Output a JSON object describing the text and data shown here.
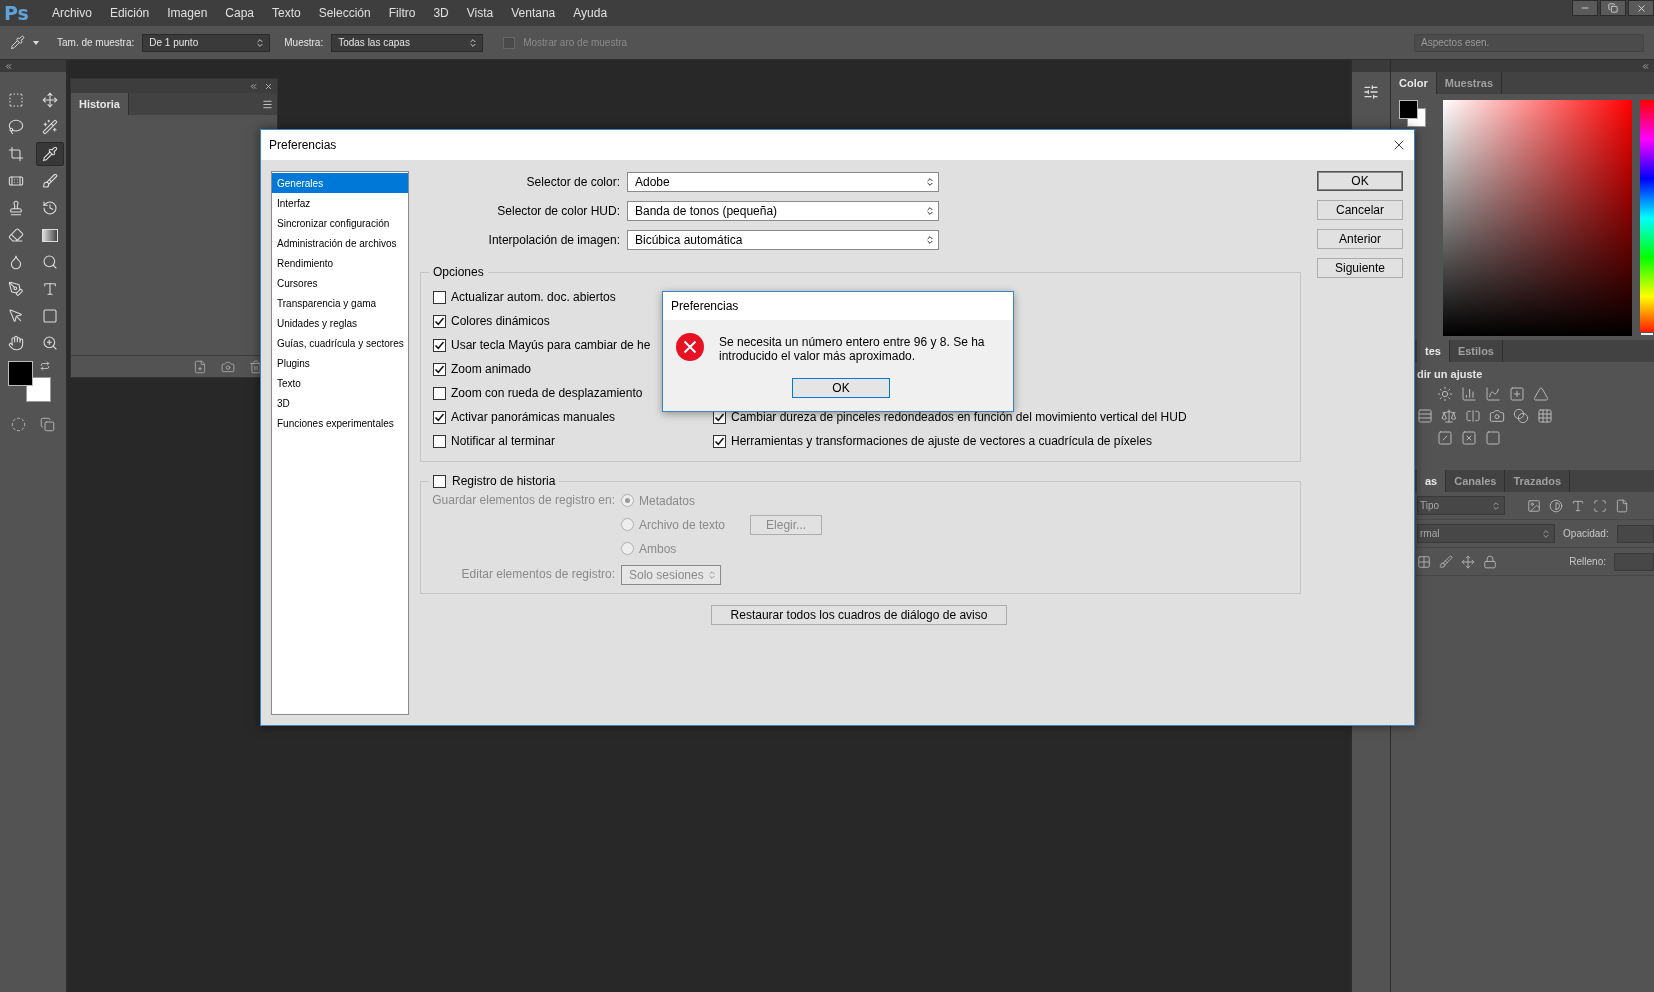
{
  "menu_bar": {
    "logo": "Ps",
    "items": [
      "Archivo",
      "Edición",
      "Imagen",
      "Capa",
      "Texto",
      "Selección",
      "Filtro",
      "3D",
      "Vista",
      "Ventana",
      "Ayuda"
    ]
  },
  "options_bar": {
    "sample_size_label": "Tam. de muestra:",
    "sample_size": "De 1 punto",
    "sample_label": "Muestra:",
    "sample": "Todas las capas",
    "show_ring": {
      "label": "Mostrar aro de muestra",
      "checked": false
    },
    "workspace": "Aspectos esen."
  },
  "tools": [
    {
      "kind": "marquee",
      "selected": false
    },
    {
      "kind": "move",
      "selected": false
    },
    {
      "kind": "lasso",
      "selected": false
    },
    {
      "kind": "quick_select",
      "selected": false
    },
    {
      "kind": "crop",
      "selected": false
    },
    {
      "kind": "eyedropper",
      "selected": true
    },
    {
      "kind": "healing",
      "selected": false
    },
    {
      "kind": "brush",
      "selected": false
    },
    {
      "kind": "stamp",
      "selected": false
    },
    {
      "kind": "history_brush",
      "selected": false
    },
    {
      "kind": "eraser",
      "selected": false
    },
    {
      "kind": "gradient",
      "selected": false
    },
    {
      "kind": "blur",
      "selected": false
    },
    {
      "kind": "dodge",
      "selected": false
    },
    {
      "kind": "pen",
      "selected": false
    },
    {
      "kind": "type",
      "selected": false
    },
    {
      "kind": "path_select",
      "selected": false
    },
    {
      "kind": "shape",
      "selected": false
    },
    {
      "kind": "hand",
      "selected": false
    },
    {
      "kind": "zoom",
      "selected": false
    }
  ],
  "history_panel": {
    "tab": "Historia"
  },
  "color_panel": {
    "tabs": [
      {
        "label": "Color",
        "selected": true
      },
      {
        "label": "Muestras",
        "selected": false
      }
    ],
    "hue": {
      "level": 0
    }
  },
  "adjustments_panel": {
    "tabs": [
      {
        "label": "tes",
        "selected": true
      },
      {
        "label": "Estilos",
        "selected": false
      }
    ],
    "heading": "dir un ajuste"
  },
  "layers_panel": {
    "tabs": [
      {
        "label": "as",
        "selected": true
      },
      {
        "label": "Canales",
        "selected": false
      },
      {
        "label": "Trazados",
        "selected": false
      }
    ],
    "filter": "Tipo",
    "blend_mode": "rmal",
    "opacity_label": "Opacidad:",
    "fill_label": "Relleno:"
  },
  "preferences_dialog": {
    "title": "Preferencias",
    "categories": [
      {
        "label": "Generales",
        "selected": true
      },
      {
        "label": "Interfaz",
        "selected": false
      },
      {
        "label": "Sincronizar configuración",
        "selected": false
      },
      {
        "label": "Administración de archivos",
        "selected": false
      },
      {
        "label": "Rendimiento",
        "selected": false
      },
      {
        "label": "Cursores",
        "selected": false
      },
      {
        "label": "Transparencia y gama",
        "selected": false
      },
      {
        "label": "Unidades y reglas",
        "selected": false
      },
      {
        "label": "Guías, cuadrícula y sectores",
        "selected": false
      },
      {
        "label": "Plugins",
        "selected": false
      },
      {
        "label": "Texto",
        "selected": false
      },
      {
        "label": "3D",
        "selected": false
      },
      {
        "label": "Funciones experimentales",
        "selected": false
      }
    ],
    "selects": [
      {
        "label": "Selector de color:",
        "value": "Adobe"
      },
      {
        "label": "Selector de color HUD:",
        "value": "Banda de tonos (pequeña)"
      },
      {
        "label": "Interpolación de imagen:",
        "value": "Bicúbica automática"
      }
    ],
    "options": {
      "legend": "Opciones",
      "left": [
        {
          "label": "Actualizar autom. doc. abiertos",
          "checked": false
        },
        {
          "label": "Colores dinámicos",
          "checked": true
        },
        {
          "label": "Usar tecla Mayús para cambiar de he",
          "checked": true
        },
        {
          "label": "Zoom animado",
          "checked": true
        },
        {
          "label": "Zoom con rueda de desplazamiento",
          "checked": false
        },
        {
          "label": "Activar panorámicas manuales",
          "checked": true
        },
        {
          "label": "Notificar al terminar",
          "checked": false
        }
      ],
      "right": [
        {
          "label": "Cambiar dureza de pinceles redondeados en función del movimiento vertical del HUD",
          "checked": true
        },
        {
          "label": "Herramientas y transformaciones de ajuste de vectores a cuadrícula de píxeles",
          "checked": true
        }
      ]
    },
    "history_log": {
      "legend": "Registro de historia",
      "checked": false,
      "disabled": true,
      "save_label": "Guardar elementos de registro en:",
      "radios": [
        {
          "label": "Metadatos",
          "selected": true
        },
        {
          "label": "Archivo de texto",
          "selected": false
        },
        {
          "label": "Ambos",
          "selected": false
        }
      ],
      "choose_button": "Elegir...",
      "edit_label": "Editar elementos de registro:",
      "edit_value": "Solo sesiones"
    },
    "restore_button": "Restaurar todos los cuadros de diálogo de aviso",
    "buttons": [
      "OK",
      "Cancelar",
      "Anterior",
      "Siguiente"
    ]
  },
  "alert": {
    "title": "Preferencias",
    "message": "Se necesita un número entero entre 96 y 8. Se ha introducido el valor más aproximado.",
    "button": "OK"
  }
}
